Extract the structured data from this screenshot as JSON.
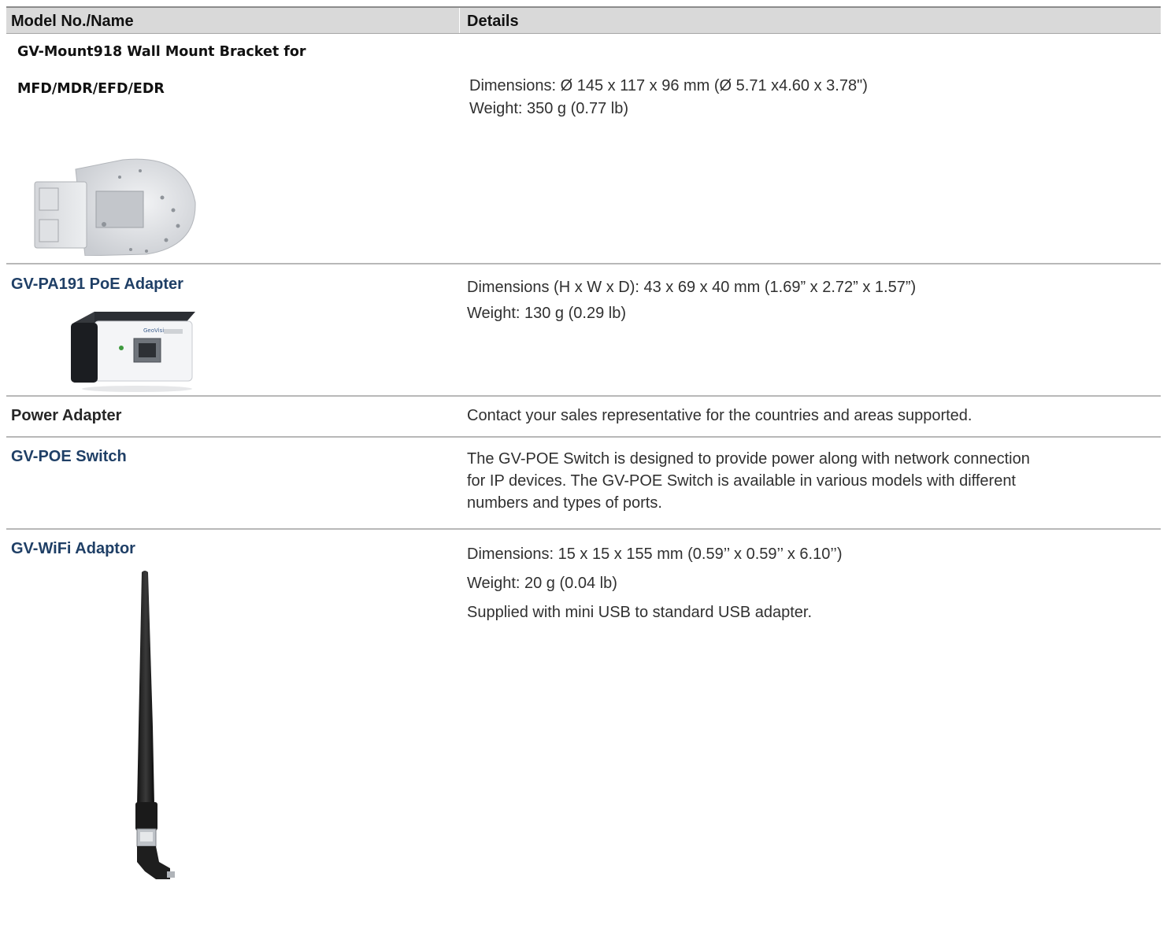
{
  "header": {
    "model": "Model No./Name",
    "details": "Details"
  },
  "rows": [
    {
      "name_line1": "GV-Mount918 Wall Mount Bracket for",
      "name_line2": "MFD/MDR/EFD/EDR",
      "details": [
        "Dimensions: Ø 145 x 117 x 96 mm (Ø 5.71 x4.60 x 3.78\")",
        "Weight: 350 g (0.77 lb)"
      ]
    },
    {
      "name": "GV-PA191 PoE Adapter",
      "details": [
        "Dimensions (H x W x D): 43 x 69 x 40 mm (1.69” x 2.72” x 1.57”)",
        "Weight: 130 g (0.29 lb)"
      ]
    },
    {
      "name": "Power Adapter",
      "details": [
        "Contact your sales representative for the countries and areas supported."
      ]
    },
    {
      "name": "GV-POE Switch",
      "details": [
        "The GV-POE Switch is designed to provide power along with network connection",
        "for IP devices. The GV-POE Switch is available in various models with different",
        "numbers and types of ports."
      ]
    },
    {
      "name": "GV-WiFi Adaptor",
      "details": [
        "Dimensions: 15 x 15 x 155 mm (0.59’’ x 0.59’’ x 6.10’’)",
        "Weight: 20 g (0.04 lb)",
        "Supplied with mini USB to standard USB adapter."
      ]
    }
  ]
}
